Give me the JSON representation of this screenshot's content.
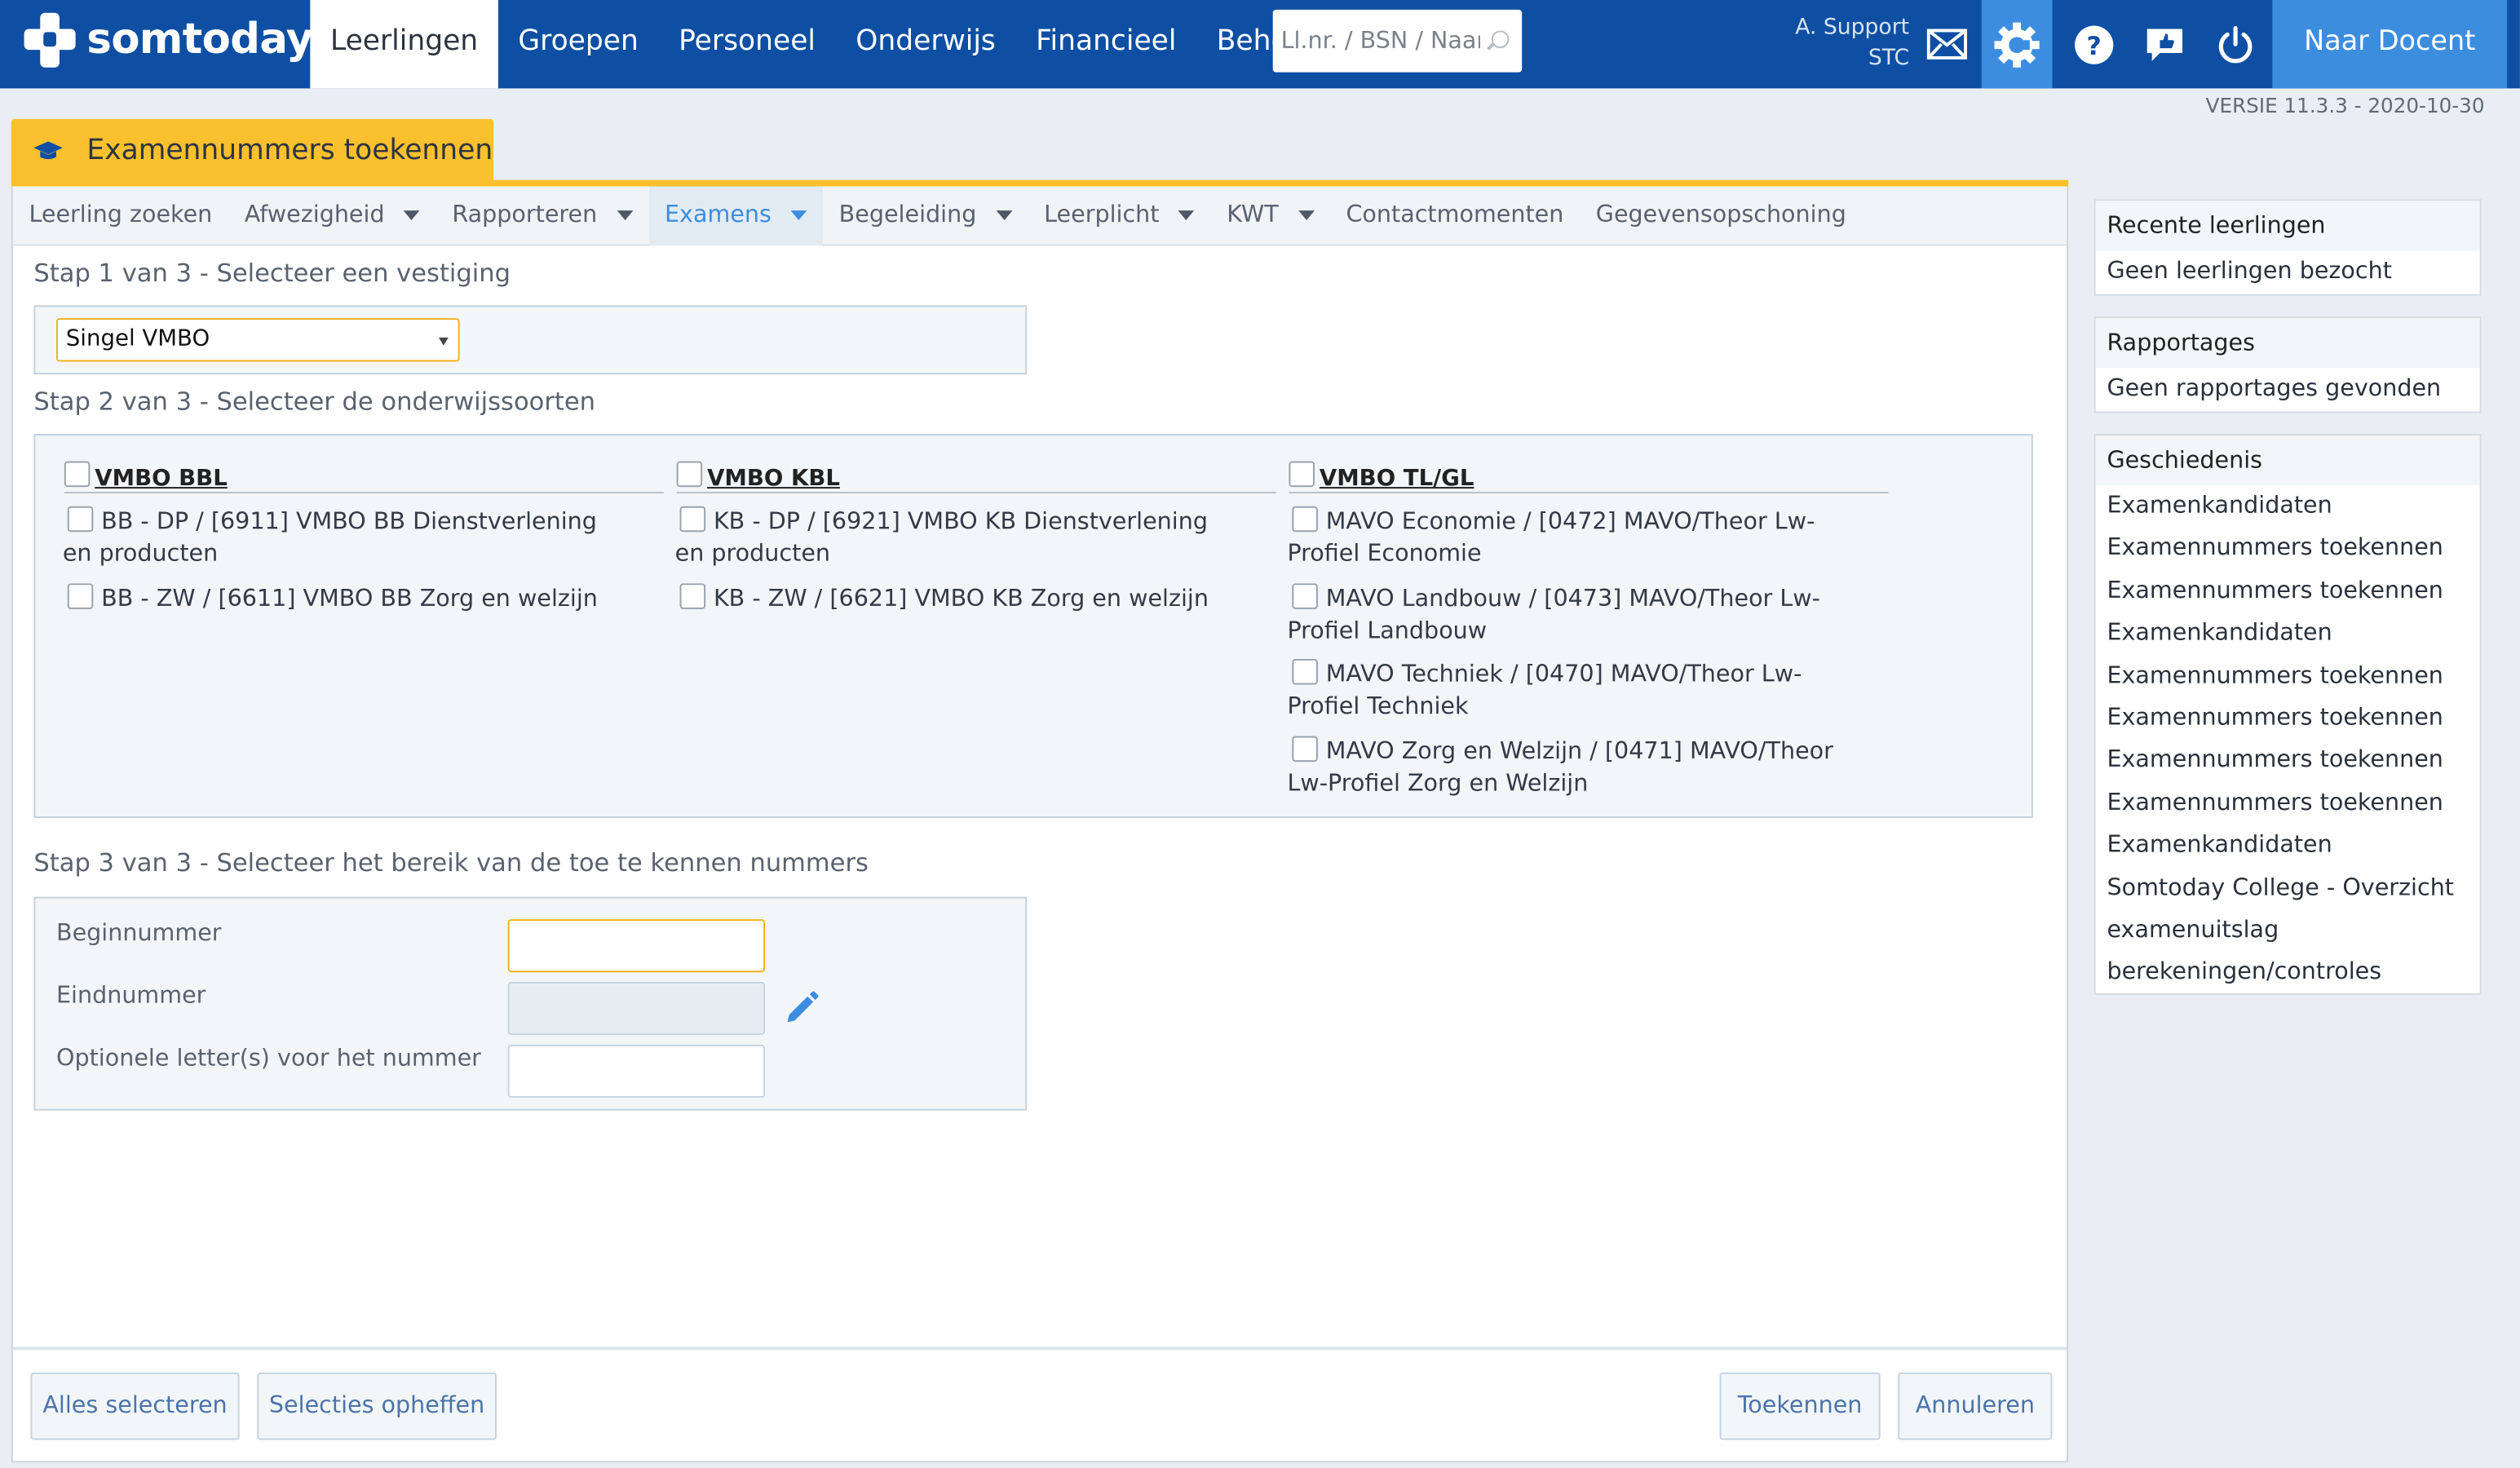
{
  "app": {
    "brand": "somtoday",
    "version": "VERSIE 11.3.3 - 2020-10-30"
  },
  "nav": {
    "items": [
      "Leerlingen",
      "Groepen",
      "Personeel",
      "Onderwijs",
      "Financieel",
      "Beheer"
    ],
    "active": "Leerlingen",
    "search_placeholder": "Ll.nr. / BSN / Naam"
  },
  "user": {
    "name": "A. Support",
    "org": "STC"
  },
  "toolbar": {
    "naar_docent": "Naar Docent"
  },
  "page": {
    "title": "Examennummers toekennen"
  },
  "subnav": {
    "items": [
      {
        "label": "Leerling zoeken",
        "dropdown": false
      },
      {
        "label": "Afwezigheid",
        "dropdown": true
      },
      {
        "label": "Rapporteren",
        "dropdown": true
      },
      {
        "label": "Examens",
        "dropdown": true,
        "active": true
      },
      {
        "label": "Begeleiding",
        "dropdown": true
      },
      {
        "label": "Leerplicht",
        "dropdown": true
      },
      {
        "label": "KWT",
        "dropdown": true
      },
      {
        "label": "Contactmomenten",
        "dropdown": false
      },
      {
        "label": "Gegevensopschoning",
        "dropdown": false
      }
    ]
  },
  "step1": {
    "title": "Stap 1 van 3 - Selecteer een vestiging",
    "selected": "Singel VMBO"
  },
  "step2": {
    "title": "Stap 2 van 3 - Selecteer de onderwijssoorten",
    "columns": [
      {
        "header": "VMBO BBL",
        "options": [
          "BB - DP / [6911] VMBO BB Dienstverlening en producten",
          "BB - ZW / [6611] VMBO BB Zorg en welzijn"
        ]
      },
      {
        "header": "VMBO KBL",
        "options": [
          "KB - DP / [6921] VMBO KB Dienstverlening en producten",
          "KB - ZW / [6621] VMBO KB Zorg en welzijn"
        ]
      },
      {
        "header": "VMBO TL/GL",
        "options": [
          "MAVO Economie / [0472] MAVO/Theor Lw-Profiel Economie",
          "MAVO Landbouw / [0473] MAVO/Theor Lw-Profiel Landbouw",
          "MAVO Techniek / [0470] MAVO/Theor Lw-Profiel Techniek",
          "MAVO Zorg en Welzijn / [0471] MAVO/Theor Lw-Profiel Zorg en Welzijn"
        ]
      }
    ]
  },
  "step3": {
    "title": "Stap 3 van 3 - Selecteer het bereik van de toe te kennen nummers",
    "fields": {
      "begin": "Beginnummer",
      "eind": "Eindnummer",
      "letters": "Optionele letter(s) voor het nummer"
    }
  },
  "buttons": {
    "select_all": "Alles selecteren",
    "clear": "Selecties opheffen",
    "assign": "Toekennen",
    "cancel": "Annuleren"
  },
  "sidebar": {
    "recent": {
      "title": "Recente leerlingen",
      "empty": "Geen leerlingen bezocht"
    },
    "reports": {
      "title": "Rapportages",
      "empty": "Geen rapportages gevonden"
    },
    "history": {
      "title": "Geschiedenis",
      "items": [
        "Examenkandidaten",
        "Examennummers toekennen",
        "Examennummers toekennen",
        "Examenkandidaten",
        "Examennummers toekennen",
        "Examennummers toekennen",
        "Examennummers toekennen",
        "Examennummers toekennen",
        "Examenkandidaten",
        "Somtoday College - Overzicht",
        "examenuitslag",
        "berekeningen/controles"
      ]
    }
  },
  "colors": {
    "topbar": "#0e4fa3",
    "accent": "#3c8de0",
    "highlight": "#fbc02d"
  }
}
